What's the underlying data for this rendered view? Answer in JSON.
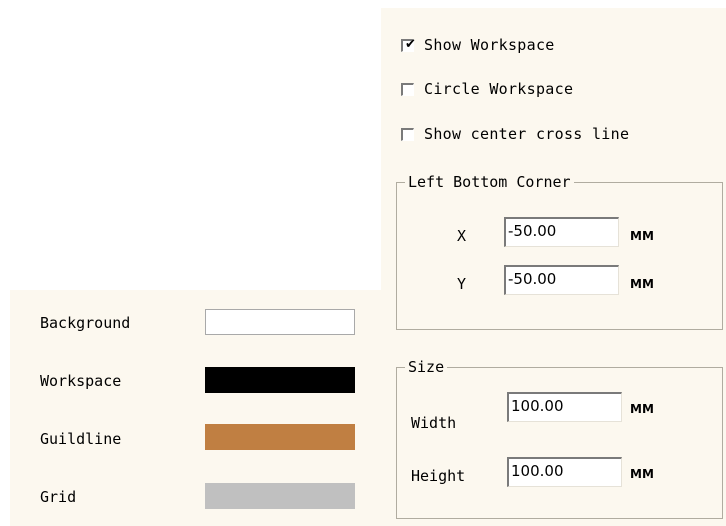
{
  "workspace_options": {
    "show_workspace": {
      "label": "Show Workspace",
      "checked": true
    },
    "circle_workspace": {
      "label": "Circle Workspace",
      "checked": false
    },
    "show_center_cross_line": {
      "label": "Show center cross line",
      "checked": false
    }
  },
  "left_bottom_corner": {
    "title": "Left Bottom Corner",
    "x_label": "X",
    "x_value": "-50.00",
    "y_label": "Y",
    "y_value": "-50.00",
    "unit": "MM"
  },
  "size": {
    "title": "Size",
    "width_label": "Width",
    "width_value": "100.00",
    "height_label": "Height",
    "height_value": "100.00",
    "unit": "MM"
  },
  "colors": {
    "background": {
      "label": "Background",
      "color": "#ffffff"
    },
    "workspace": {
      "label": "Workspace",
      "color": "#000000"
    },
    "guildline": {
      "label": "Guildline",
      "color": "#c07f42"
    },
    "grid": {
      "label": "Grid",
      "color": "#c0c0c0"
    }
  },
  "icons": {
    "checkmark": "check-icon"
  }
}
